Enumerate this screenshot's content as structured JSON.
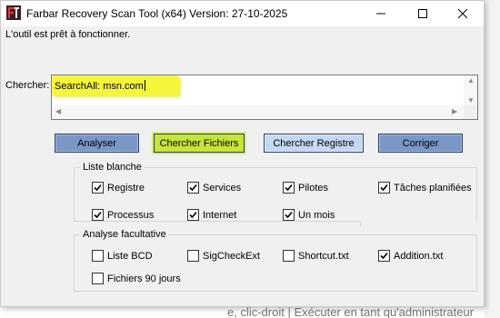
{
  "window": {
    "title": "Farbar Recovery Scan Tool (x64) Version: 27-10-2025",
    "status": "L'outil est prêt à fonctionner."
  },
  "search": {
    "label": "Chercher:",
    "value": "SearchAll: msn.com"
  },
  "buttons": {
    "analyser": "Analyser",
    "chercher_fichiers": "Chercher Fichiers",
    "chercher_registre": "Chercher Registre",
    "corriger": "Corriger"
  },
  "liste_blanche": {
    "title": "Liste blanche",
    "items": [
      {
        "label": "Registre",
        "checked": true
      },
      {
        "label": "Services",
        "checked": true
      },
      {
        "label": "Pilotes",
        "checked": true
      },
      {
        "label": "Tâches planifiées",
        "checked": true
      },
      {
        "label": "Processus",
        "checked": true
      },
      {
        "label": "Internet",
        "checked": true
      },
      {
        "label": "Un mois",
        "checked": true
      }
    ]
  },
  "analyse_facultative": {
    "title": "Analyse facultative",
    "items": [
      {
        "label": "Liste BCD",
        "checked": false
      },
      {
        "label": "SigCheckExt",
        "checked": false
      },
      {
        "label": "Shortcut.txt",
        "checked": false
      },
      {
        "label": "Addition.txt",
        "checked": true
      },
      {
        "label": "Fichiers 90 jours",
        "checked": false
      }
    ]
  },
  "background": {
    "text": "e, clic-droit | Exécuter en tant qu'administrateur"
  },
  "colors": {
    "button_blue": "#7b97c6",
    "button_active_green": "#c9e336",
    "button_light_blue": "#c5d8f1",
    "search_highlight": "#f5f53c"
  }
}
